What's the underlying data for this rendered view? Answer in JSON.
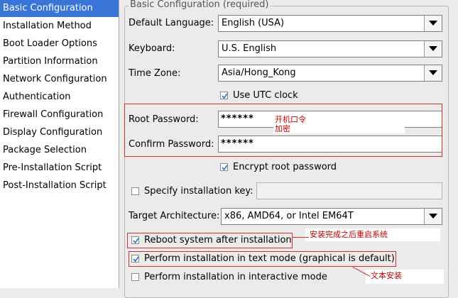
{
  "sidebar": {
    "items": [
      {
        "label": "Basic Configuration",
        "active": true
      },
      {
        "label": "Installation Method"
      },
      {
        "label": "Boot Loader Options"
      },
      {
        "label": "Partition Information"
      },
      {
        "label": "Network Configuration"
      },
      {
        "label": "Authentication"
      },
      {
        "label": "Firewall Configuration"
      },
      {
        "label": "Display Configuration"
      },
      {
        "label": "Package Selection"
      },
      {
        "label": "Pre-Installation Script"
      },
      {
        "label": "Post-Installation Script"
      }
    ]
  },
  "main": {
    "group_title": "Basic Configuration (required)",
    "default_language": {
      "label": "Default Language:",
      "value": "English (USA)"
    },
    "keyboard": {
      "label": "Keyboard:",
      "value": "U.S. English"
    },
    "time_zone": {
      "label": "Time Zone:",
      "value": "Asia/Hong_Kong"
    },
    "use_utc": {
      "label": "Use UTC clock",
      "checked": true
    },
    "root_password": {
      "label": "Root Password:",
      "value": "******"
    },
    "confirm_password": {
      "label": "Confirm Password:",
      "value": "******"
    },
    "encrypt_root": {
      "label": "Encrypt root password",
      "checked": true
    },
    "install_key": {
      "label": "Specify installation key:",
      "checked": false,
      "value": ""
    },
    "target_arch": {
      "label": "Target Architecture:",
      "value": "x86, AMD64, or Intel EM64T"
    },
    "reboot": {
      "label": "Reboot system after installation",
      "checked": true
    },
    "text_mode": {
      "label": "Perform installation in text mode (graphical is default)",
      "checked": true
    },
    "interactive": {
      "label": "Perform installation in interactive mode",
      "checked": false
    }
  },
  "annotations": {
    "password_note_1": "开机口令",
    "password_note_2": "加密",
    "reboot_note": "安装完成之后重启系统",
    "text_mode_note": "文本安装",
    "color": "#d03030"
  },
  "colors": {
    "selection": "#3875d7",
    "window_bg": "#ebebeb"
  }
}
